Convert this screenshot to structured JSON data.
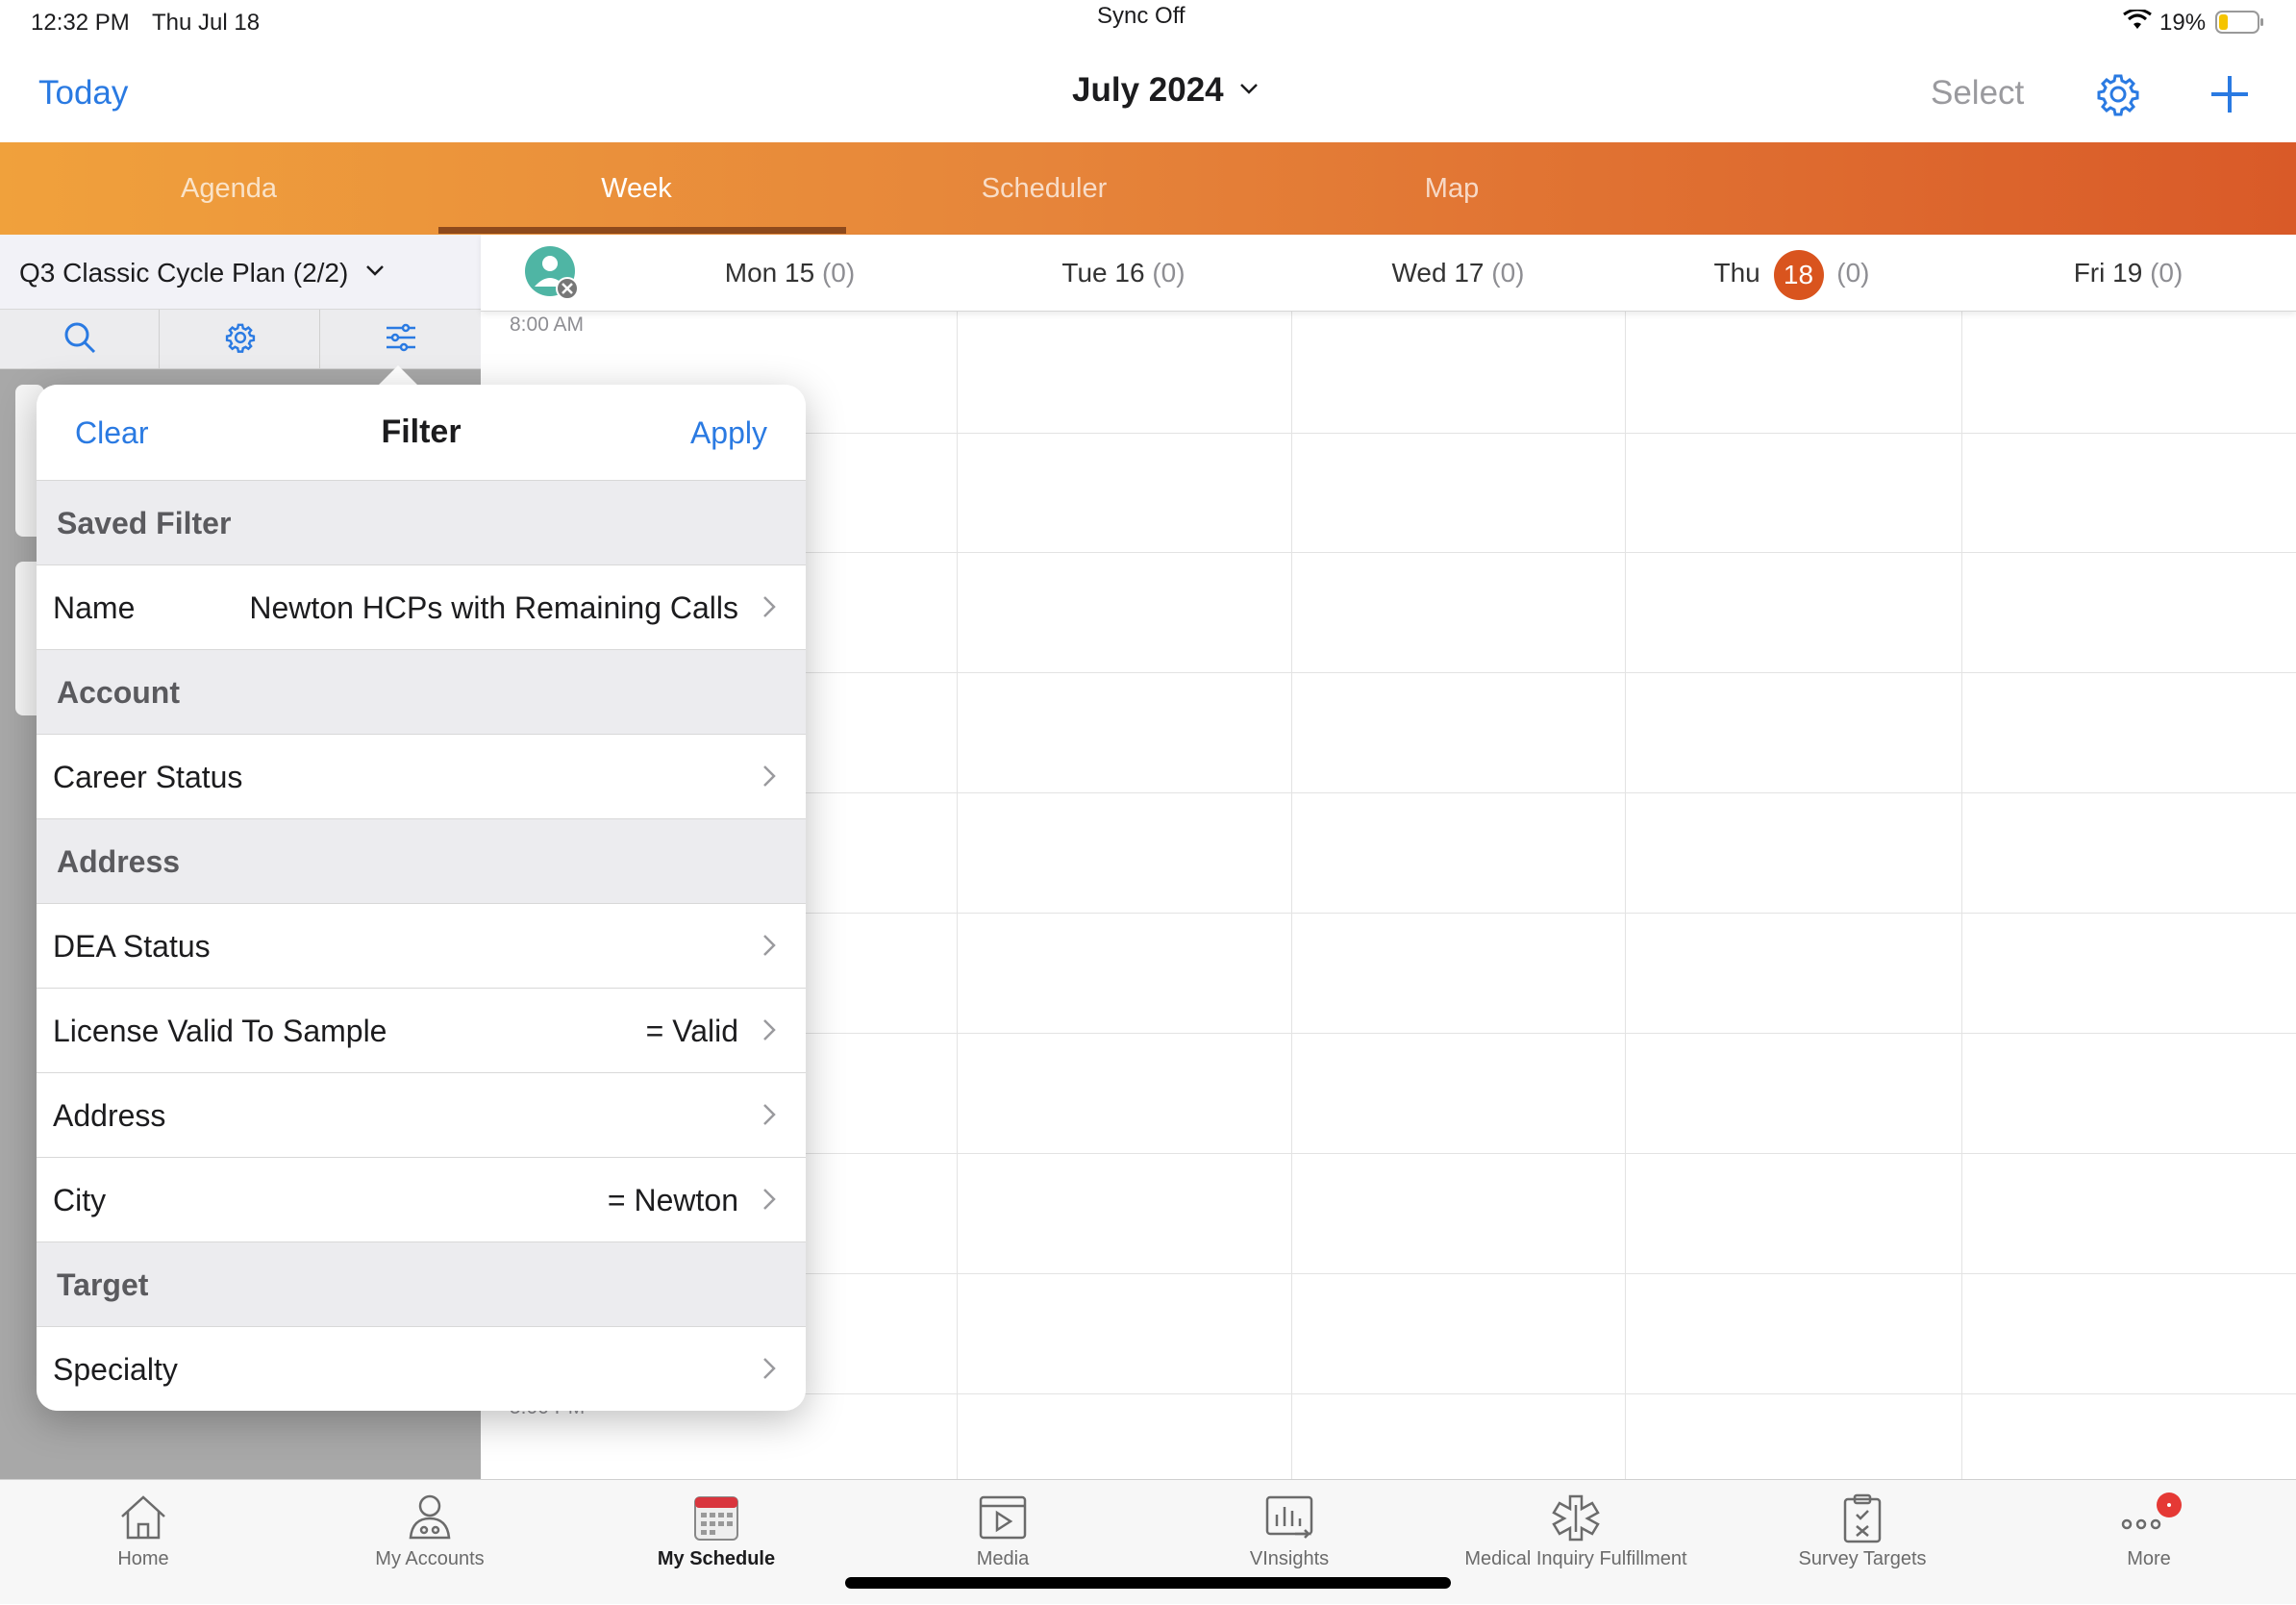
{
  "status_bar": {
    "time": "12:32 PM",
    "date": "Thu Jul 18",
    "center": "Sync Off",
    "battery": "19%"
  },
  "nav": {
    "today": "Today",
    "title": "July 2024",
    "select": "Select"
  },
  "tabs": [
    {
      "label": "Agenda"
    },
    {
      "label": "Week"
    },
    {
      "label": "Scheduler"
    },
    {
      "label": "Map"
    }
  ],
  "plan": {
    "label": "Q3 Classic Cycle Plan (2/2)"
  },
  "days": [
    {
      "name": "Mon 15",
      "count": "(0)"
    },
    {
      "name": "Tue 16",
      "count": "(0)"
    },
    {
      "name": "Wed 17",
      "count": "(0)"
    },
    {
      "name": "Thu",
      "num": "18",
      "count": "(0)"
    },
    {
      "name": "Fri 19",
      "count": "(0)"
    }
  ],
  "times": {
    "first": "8:00 AM",
    "last": "5:00 PM"
  },
  "filter": {
    "clear": "Clear",
    "title": "Filter",
    "apply": "Apply",
    "sections": {
      "saved": "Saved Filter",
      "account": "Account",
      "address": "Address",
      "target": "Target"
    },
    "rows": {
      "name": {
        "label": "Name",
        "value": "Newton HCPs with Remaining Calls"
      },
      "career": {
        "label": "Career Status",
        "value": ""
      },
      "dea": {
        "label": "DEA Status",
        "value": ""
      },
      "license": {
        "label": "License Valid To Sample",
        "value": "= Valid"
      },
      "address": {
        "label": "Address",
        "value": ""
      },
      "city": {
        "label": "City",
        "value": "= Newton"
      },
      "specialty": {
        "label": "Specialty",
        "value": ""
      }
    }
  },
  "bottom_tabs": [
    {
      "label": "Home",
      "icon": "home-icon"
    },
    {
      "label": "My Accounts",
      "icon": "accounts-icon"
    },
    {
      "label": "My Schedule",
      "icon": "calendar-icon"
    },
    {
      "label": "Media",
      "icon": "media-icon"
    },
    {
      "label": "VInsights",
      "icon": "insights-icon"
    },
    {
      "label": "Medical Inquiry Fulfillment",
      "icon": "medical-icon"
    },
    {
      "label": "Survey Targets",
      "icon": "survey-icon"
    },
    {
      "label": "More",
      "icon": "more-icon"
    }
  ],
  "colors": {
    "accent": "#2a7ae2",
    "today_badge": "#d9541e",
    "tab_gradient_start": "#f0a13c",
    "tab_gradient_end": "#d95a28",
    "notification": "#e53935"
  }
}
